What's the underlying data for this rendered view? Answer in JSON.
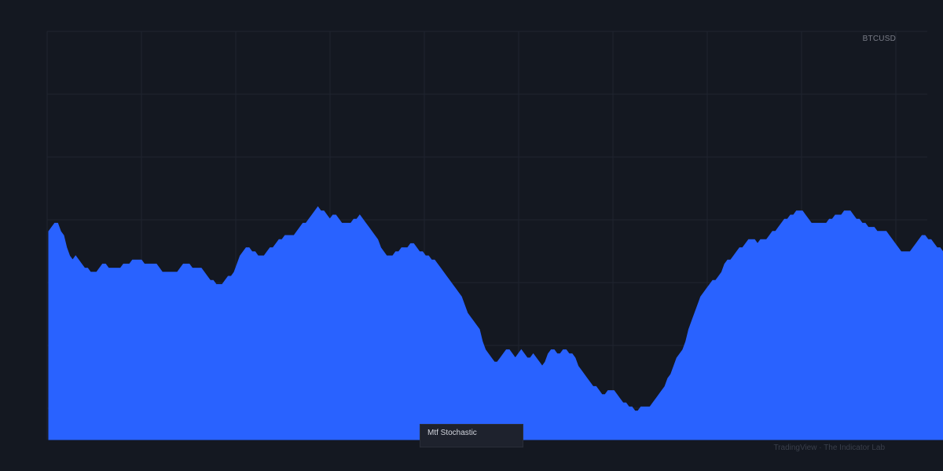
{
  "chart_data": {
    "type": "area",
    "symbol": "BTCUSD",
    "indicator_name": "Mtf Stochastic",
    "watermark": "TradingView · The Indicator Lab",
    "grid": true,
    "ylim": [
      0,
      100
    ],
    "values": [
      51,
      52,
      53,
      53,
      51,
      50,
      47,
      45,
      44,
      45,
      44,
      43,
      42,
      42,
      41,
      41,
      41,
      42,
      43,
      43,
      42,
      42,
      42,
      42,
      42,
      43,
      43,
      43,
      44,
      44,
      44,
      44,
      43,
      43,
      43,
      43,
      43,
      42,
      41,
      41,
      41,
      41,
      41,
      41,
      42,
      43,
      43,
      43,
      42,
      42,
      42,
      42,
      41,
      40,
      39,
      39,
      38,
      38,
      38,
      39,
      40,
      40,
      41,
      43,
      45,
      46,
      47,
      47,
      46,
      46,
      45,
      45,
      45,
      46,
      47,
      47,
      48,
      49,
      49,
      50,
      50,
      50,
      50,
      51,
      52,
      53,
      53,
      54,
      55,
      56,
      57,
      56,
      56,
      55,
      54,
      55,
      55,
      54,
      53,
      53,
      53,
      53,
      54,
      54,
      55,
      54,
      53,
      52,
      51,
      50,
      49,
      47,
      46,
      45,
      45,
      45,
      46,
      46,
      47,
      47,
      47,
      48,
      48,
      47,
      46,
      46,
      45,
      45,
      44,
      44,
      43,
      42,
      41,
      40,
      39,
      38,
      37,
      36,
      35,
      33,
      31,
      30,
      29,
      28,
      27,
      24,
      22,
      21,
      20,
      19,
      19,
      20,
      21,
      22,
      22,
      21,
      20,
      21,
      22,
      21,
      20,
      20,
      21,
      20,
      19,
      18,
      19,
      21,
      22,
      22,
      21,
      21,
      22,
      22,
      21,
      21,
      20,
      18,
      17,
      16,
      15,
      14,
      13,
      13,
      12,
      11,
      11,
      12,
      12,
      12,
      11,
      10,
      9,
      9,
      8,
      8,
      7,
      7,
      8,
      8,
      8,
      8,
      9,
      10,
      11,
      12,
      13,
      15,
      16,
      18,
      20,
      21,
      22,
      24,
      27,
      29,
      31,
      33,
      35,
      36,
      37,
      38,
      39,
      39,
      40,
      41,
      43,
      44,
      44,
      45,
      46,
      47,
      47,
      48,
      49,
      49,
      49,
      48,
      49,
      49,
      49,
      50,
      51,
      51,
      52,
      53,
      54,
      54,
      55,
      55,
      56,
      56,
      56,
      55,
      54,
      53,
      53,
      53,
      53,
      53,
      53,
      54,
      54,
      55,
      55,
      55,
      56,
      56,
      56,
      55,
      54,
      54,
      53,
      53,
      52,
      52,
      52,
      51,
      51,
      51,
      51,
      50,
      49,
      48,
      47,
      46,
      46,
      46,
      46,
      47,
      48,
      49,
      50,
      50,
      49,
      49,
      48,
      47,
      47,
      46
    ]
  }
}
